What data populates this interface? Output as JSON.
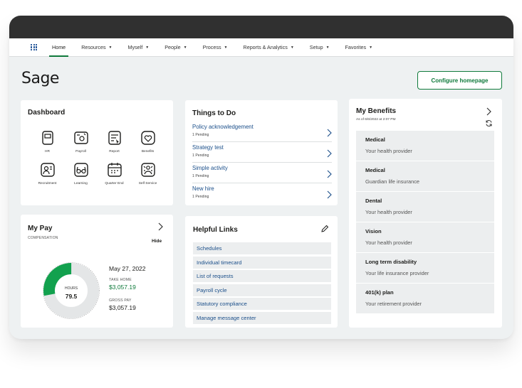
{
  "nav": {
    "items": [
      {
        "label": "Home",
        "caret": ""
      },
      {
        "label": "Resources",
        "caret": "▼"
      },
      {
        "label": "Myself",
        "caret": "▼"
      },
      {
        "label": "People",
        "caret": "▼"
      },
      {
        "label": "Process",
        "caret": "▼"
      },
      {
        "label": "Reports & Analytics",
        "caret": "▼"
      },
      {
        "label": "Setup",
        "caret": "▼"
      },
      {
        "label": "Favorites",
        "caret": "▼"
      }
    ]
  },
  "header": {
    "logo": "Sage",
    "configure_button": "Configure homepage"
  },
  "dashboard": {
    "title": "Dashboard",
    "items": [
      {
        "label": "HR",
        "icon": "hr-icon"
      },
      {
        "label": "Payroll",
        "icon": "payroll-icon"
      },
      {
        "label": "Report",
        "icon": "report-icon"
      },
      {
        "label": "Benefits",
        "icon": "benefits-icon"
      },
      {
        "label": "Recruitment",
        "icon": "recruitment-icon"
      },
      {
        "label": "Learning",
        "icon": "learning-icon"
      },
      {
        "label": "Quarter End",
        "icon": "quarter-end-icon"
      },
      {
        "label": "Self Service",
        "icon": "self-service-icon"
      }
    ]
  },
  "my_pay": {
    "title": "My Pay",
    "subtitle": "COMPENSATION",
    "hide_label": "Hide",
    "hours_label": "HOURS",
    "hours_value": "79.5",
    "hours_fraction": 0.28,
    "date": "May 27, 2022",
    "take_home_label": "TAKE HOME",
    "take_home_value": "$3,057.19",
    "gross_pay_label": "GROSS PAY",
    "gross_pay_value": "$3,057.19"
  },
  "things_to_do": {
    "title": "Things to Do",
    "items": [
      {
        "title": "Policy acknowledgement",
        "status": "1 Pending"
      },
      {
        "title": "Strategy test",
        "status": "1 Pending"
      },
      {
        "title": "Simple activity",
        "status": "1 Pending"
      },
      {
        "title": "New hire",
        "status": "1 Pending"
      }
    ]
  },
  "helpful_links": {
    "title": "Helpful Links",
    "items": [
      "Schedules",
      "Individual timecard",
      "List of requests",
      "Payroll cycle",
      "Statutory compliance",
      "Manage message center"
    ]
  },
  "my_benefits": {
    "title": "My Benefits",
    "as_of": "As of 6/6/2022 at 2:07 PM",
    "items": [
      {
        "name": "Medical",
        "provider": "Your health provider"
      },
      {
        "name": "Medical",
        "provider": "Guardian life insurance"
      },
      {
        "name": "Dental",
        "provider": "Your health provider"
      },
      {
        "name": "Vision",
        "provider": "Your health provider"
      },
      {
        "name": "Long term disability",
        "provider": "Your life insurance provider"
      },
      {
        "name": "401(k) plan",
        "provider": "Your retirement provider"
      }
    ]
  },
  "colors": {
    "brand_green": "#0f7a3b",
    "link_blue": "#1b4f8a",
    "topbar": "#303030"
  }
}
